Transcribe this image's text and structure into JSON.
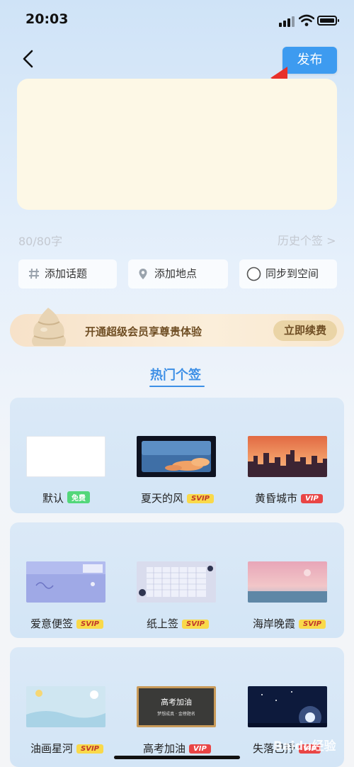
{
  "status_bar": {
    "time": "20:03"
  },
  "header": {
    "publish_label": "发布"
  },
  "editor": {
    "counter": "80/80字",
    "history_label": "历史个签 >"
  },
  "chips": [
    {
      "label": "添加话题",
      "icon": "hash-icon"
    },
    {
      "label": "添加地点",
      "icon": "location-pin-icon"
    },
    {
      "label": "同步到空间",
      "icon": "radio-circle-icon"
    }
  ],
  "vip_banner": {
    "text": "开通超级会员享尊贵体验",
    "button": "立即续费"
  },
  "section": {
    "title": "热门个签"
  },
  "templates": [
    {
      "name": "默认",
      "badge": "免费",
      "badge_type": "free"
    },
    {
      "name": "夏天的风",
      "badge": "SVIP",
      "badge_type": "svip"
    },
    {
      "name": "黄昏城市",
      "badge": "VIP",
      "badge_type": "vip"
    },
    {
      "name": "爱意便签",
      "badge": "SVIP",
      "badge_type": "svip"
    },
    {
      "name": "纸上签",
      "badge": "SVIP",
      "badge_type": "svip"
    },
    {
      "name": "海岸晚霞",
      "badge": "SVIP",
      "badge_type": "svip"
    },
    {
      "name": "油画星河",
      "badge": "SVIP",
      "badge_type": "svip"
    },
    {
      "name": "高考加油",
      "badge": "VIP",
      "badge_type": "vip"
    },
    {
      "name": "失落已抒",
      "badge": "VIP",
      "badge_type": "vip"
    }
  ],
  "thumb_text": {
    "exam": "高考加油",
    "exam_sub": "梦想成真 · 金榜题名"
  },
  "watermark": "Baidu经验",
  "colors": {
    "accent": "#3d9bf0",
    "editor_bg": "#fdf8e6",
    "annotation_arrow": "#e8302a"
  }
}
